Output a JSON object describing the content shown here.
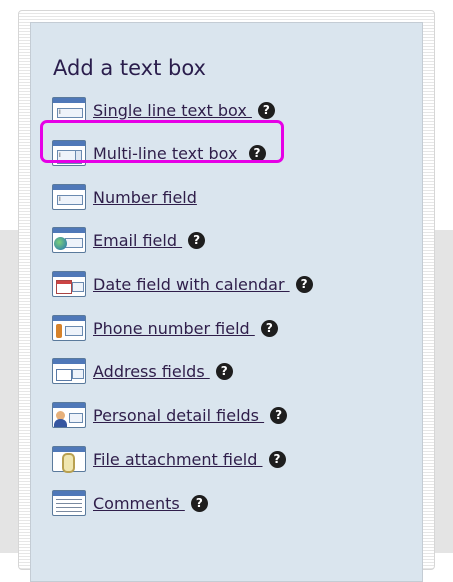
{
  "panel": {
    "title": "Add a text box",
    "items": [
      {
        "label": "Single line text box ",
        "icon": "single-line-textbox-icon",
        "help": true
      },
      {
        "label": "Multi-line text box ",
        "icon": "multi-line-textbox-icon",
        "help": true
      },
      {
        "label": "Number field",
        "icon": "number-field-icon",
        "help": false
      },
      {
        "label": "Email field ",
        "icon": "email-field-icon",
        "help": true
      },
      {
        "label": "Date field with calendar ",
        "icon": "calendar-field-icon",
        "help": true
      },
      {
        "label": "Phone number field ",
        "icon": "phone-field-icon",
        "help": true
      },
      {
        "label": "Address fields ",
        "icon": "address-field-icon",
        "help": true
      },
      {
        "label": "Personal detail fields ",
        "icon": "personal-detail-icon",
        "help": true
      },
      {
        "label": "File attachment field ",
        "icon": "file-attachment-icon",
        "help": true
      },
      {
        "label": "Comments ",
        "icon": "comments-icon",
        "help": true
      }
    ],
    "help_glyph": "?"
  },
  "colors": {
    "panel_bg": "#dae5ee",
    "link": "#2f1e4a",
    "highlight": "#e600e6"
  }
}
